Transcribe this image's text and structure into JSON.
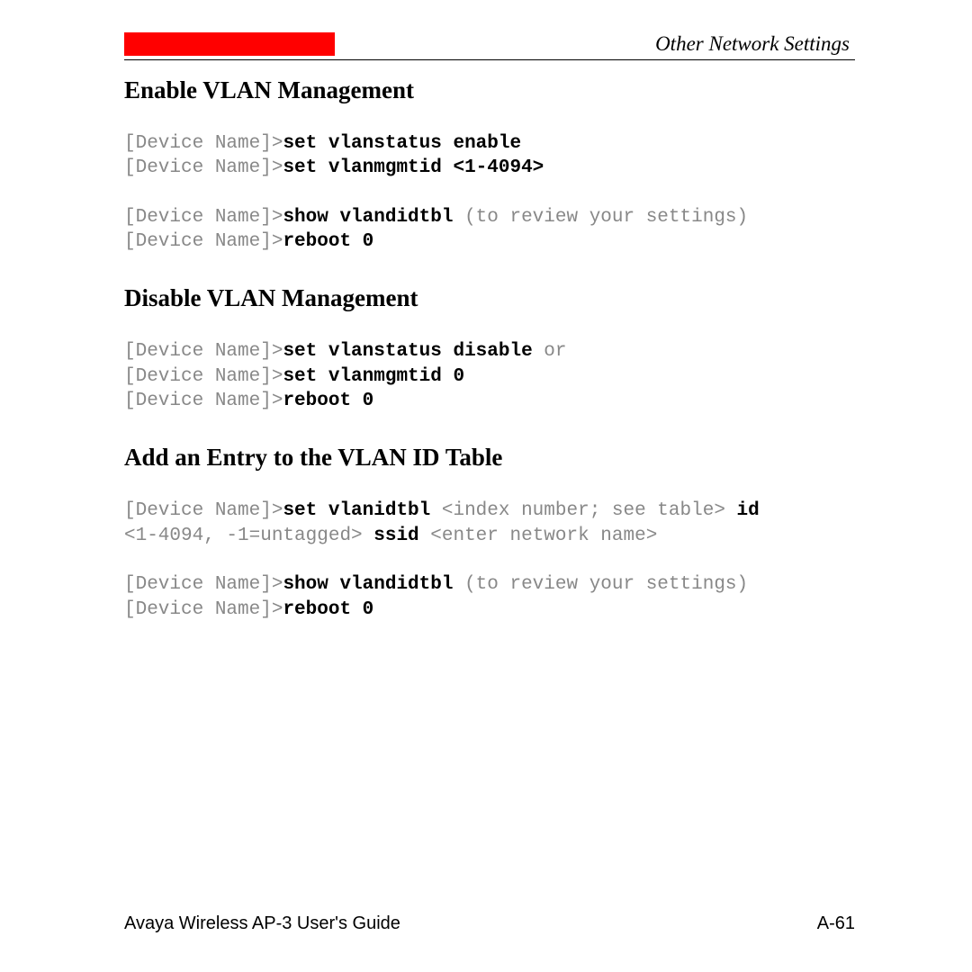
{
  "header": {
    "title": "Other Network Settings"
  },
  "sections": {
    "enable": {
      "heading": "Enable VLAN Management",
      "line1_prompt": "[Device Name]>",
      "line1_cmd": "set vlanstatus enable",
      "line2_prompt": "[Device Name]>",
      "line2_cmd": "set vlanmgmtid <1-4094>",
      "line3_prompt": "[Device Name]>",
      "line3_cmd": "show vlandidtbl",
      "line3_note": " (to review your settings)",
      "line4_prompt": "[Device Name]>",
      "line4_cmd": "reboot 0"
    },
    "disable": {
      "heading": "Disable VLAN Management",
      "line1_prompt": "[Device Name]>",
      "line1_cmd": "set vlanstatus disable",
      "line1_suffix": " or",
      "line2_prompt": "[Device Name]>",
      "line2_cmd": "set vlanmgmtid 0",
      "line3_prompt": "[Device Name]>",
      "line3_cmd": "reboot 0"
    },
    "add": {
      "heading": "Add an Entry to the VLAN ID Table",
      "line1_prompt": "[Device Name]>",
      "line1_cmd": "set vlanidtbl",
      "line1_arg": " <index number; see table> ",
      "line1_cmd2": "id",
      "line2_pre": "<1-4094, -1=untagged> ",
      "line2_cmd": "ssid",
      "line2_arg": " <enter network name>",
      "line3_prompt": "[Device Name]>",
      "line3_cmd": "show vlandidtbl",
      "line3_note": " (to review your settings)",
      "line4_prompt": "[Device Name]>",
      "line4_cmd": "reboot 0"
    }
  },
  "footer": {
    "left": "Avaya Wireless AP-3 User's Guide",
    "right": "A-61"
  }
}
